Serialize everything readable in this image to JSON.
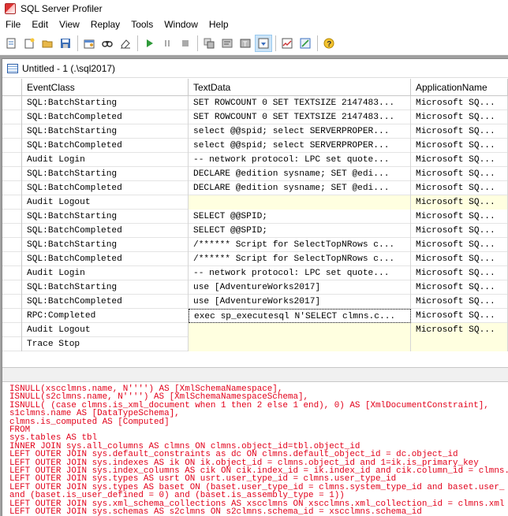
{
  "app": {
    "title": "SQL Server Profiler"
  },
  "menu": [
    "File",
    "Edit",
    "View",
    "Replay",
    "Tools",
    "Window",
    "Help"
  ],
  "toolbar": {
    "buttons": [
      {
        "name": "new-trace-icon"
      },
      {
        "name": "new-template-icon"
      },
      {
        "name": "open-icon"
      },
      {
        "name": "save-icon"
      },
      {
        "name": "properties-icon"
      },
      {
        "name": "find-icon"
      },
      {
        "name": "clear-trace-icon"
      },
      {
        "name": "run-trace-icon"
      },
      {
        "name": "pause-trace-icon"
      },
      {
        "name": "stop-trace-icon"
      },
      {
        "name": "events-icon"
      },
      {
        "name": "filters-icon"
      },
      {
        "name": "column-icon"
      },
      {
        "name": "autoscroll-icon"
      },
      {
        "name": "activity-monitor-icon"
      },
      {
        "name": "tuning-advisor-icon"
      },
      {
        "name": "help-icon"
      }
    ]
  },
  "document": {
    "title": "Untitled - 1 (.\\sql2017)"
  },
  "grid": {
    "columns": [
      "EventClass",
      "TextData",
      "ApplicationName"
    ],
    "rows": [
      {
        "event": "SQL:BatchStarting",
        "text": "SET ROWCOUNT 0 SET TEXTSIZE 2147483...",
        "app": "Microsoft SQ..."
      },
      {
        "event": "SQL:BatchCompleted",
        "text": "SET ROWCOUNT 0 SET TEXTSIZE 2147483...",
        "app": "Microsoft SQ..."
      },
      {
        "event": "SQL:BatchStarting",
        "text": "select @@spid;  select SERVERPROPER...",
        "app": "Microsoft SQ..."
      },
      {
        "event": "SQL:BatchCompleted",
        "text": "select @@spid;  select SERVERPROPER...",
        "app": "Microsoft SQ..."
      },
      {
        "event": "Audit Login",
        "text": "-- network protocol: LPC  set quote...",
        "app": "Microsoft SQ..."
      },
      {
        "event": "SQL:BatchStarting",
        "text": "DECLARE @edition sysname;  SET @edi...",
        "app": "Microsoft SQ..."
      },
      {
        "event": "SQL:BatchCompleted",
        "text": "DECLARE @edition sysname;  SET @edi...",
        "app": "Microsoft SQ..."
      },
      {
        "event": "Audit Logout",
        "text": "",
        "app": "Microsoft SQ..."
      },
      {
        "event": "SQL:BatchStarting",
        "text": "SELECT @@SPID;",
        "app": "Microsoft SQ..."
      },
      {
        "event": "SQL:BatchCompleted",
        "text": "SELECT @@SPID;",
        "app": "Microsoft SQ..."
      },
      {
        "event": "SQL:BatchStarting",
        "text": "/****** Script for SelectTopNRows c...",
        "app": "Microsoft SQ..."
      },
      {
        "event": "SQL:BatchCompleted",
        "text": "/****** Script for SelectTopNRows c...",
        "app": "Microsoft SQ..."
      },
      {
        "event": "Audit Login",
        "text": "-- network protocol: LPC  set quote...",
        "app": "Microsoft SQ..."
      },
      {
        "event": "SQL:BatchStarting",
        "text": "use [AdventureWorks2017]",
        "app": "Microsoft SQ..."
      },
      {
        "event": "SQL:BatchCompleted",
        "text": "use [AdventureWorks2017]",
        "app": "Microsoft SQ..."
      },
      {
        "event": "RPC:Completed",
        "text": "exec sp_executesql N'SELECT clmns.c...",
        "app": "Microsoft SQ..."
      },
      {
        "event": "Audit Logout",
        "text": "",
        "app": "Microsoft SQ..."
      },
      {
        "event": "Trace Stop",
        "text": "",
        "app": ""
      }
    ],
    "selected_row": 15
  },
  "detail_text": [
    "ISNULL(xscclmns.name, N'''') AS [XmlSchemaNamespace],",
    "ISNULL(s2clmns.name, N'''') AS [XmlSchemaNamespaceSchema],",
    "ISNULL( (case clmns.is_xml_document when 1 then 2 else 1 end), 0) AS [XmlDocumentConstraint],",
    "s1clmns.name AS [DataTypeSchema],",
    "clmns.is_computed AS [Computed]",
    "FROM",
    "sys.tables AS tbl",
    "INNER JOIN sys.all_columns AS clmns ON clmns.object_id=tbl.object_id",
    "LEFT OUTER JOIN sys.default_constraints as dc ON clmns.default_object_id = dc.object_id",
    "LEFT OUTER JOIN sys.indexes AS ik ON ik.object_id = clmns.object_id and 1=ik.is_primary_key",
    "LEFT OUTER JOIN sys.index_columns AS cik ON cik.index_id = ik.index_id and cik.column_id = clmns.",
    "LEFT OUTER JOIN sys.types AS usrt ON usrt.user_type_id = clmns.user_type_id",
    "LEFT OUTER JOIN sys.types AS baset ON (baset.user_type_id = clmns.system_type_id and baset.user_",
    "and (baset.is_user_defined = 0) and (baset.is_assembly_type = 1))",
    "LEFT OUTER JOIN sys.xml_schema_collections AS xscclmns ON xscclmns.xml_collection_id = clmns.xml",
    "LEFT OUTER JOIN sys.schemas AS s2clmns ON s2clmns.schema_id = xscclmns.schema_id"
  ]
}
